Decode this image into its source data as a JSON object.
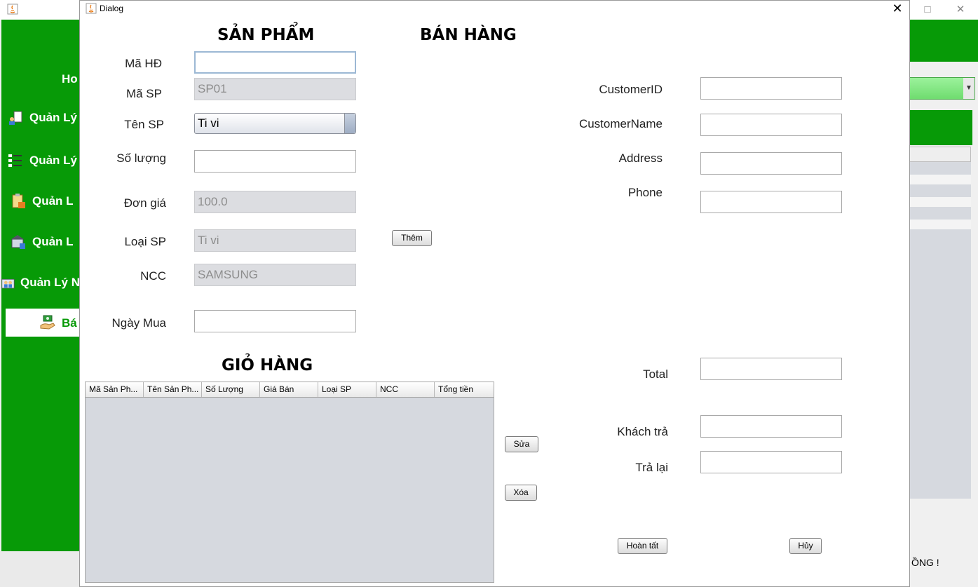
{
  "background": {
    "sidebar_items": [
      "Ho",
      "Quản Lý",
      "Quản Lý",
      "Quản L",
      "Quản L",
      "Quản Lý N",
      "Bá"
    ],
    "status_text": "ỒNG !",
    "window_controls": [
      "□",
      "✕"
    ]
  },
  "dialog": {
    "title": "Dialog",
    "close": "✕",
    "headings": {
      "product": "SẢN PHẨM",
      "sales": "BÁN HÀNG",
      "cart": "GIỎ HÀNG"
    },
    "product_form": {
      "invoice_id": {
        "label": "Mã HĐ",
        "value": ""
      },
      "product_id": {
        "label": "Mã SP",
        "value": "SP01"
      },
      "product_name": {
        "label": "Tên SP",
        "value": "Ti vi"
      },
      "quantity": {
        "label": "Số lượng",
        "value": ""
      },
      "unit_price": {
        "label": "Đơn giá",
        "value": "100.0"
      },
      "category": {
        "label": "Loại SP",
        "value": "Ti vi"
      },
      "supplier": {
        "label": "NCC",
        "value": "SAMSUNG"
      },
      "purchase_date": {
        "label": "Ngày Mua",
        "value": ""
      }
    },
    "customer_form": {
      "customer_id": {
        "label": "CustomerID",
        "value": ""
      },
      "customer_name": {
        "label": "CustomerName",
        "value": ""
      },
      "address": {
        "label": "Address",
        "value": ""
      },
      "phone": {
        "label": "Phone",
        "value": ""
      }
    },
    "payment": {
      "total": {
        "label": "Total",
        "value": ""
      },
      "paid": {
        "label": "Khách trả",
        "value": ""
      },
      "change": {
        "label": "Trả lại",
        "value": ""
      }
    },
    "buttons": {
      "add": "Thêm",
      "edit": "Sửa",
      "delete": "Xóa",
      "complete": "Hoàn tất",
      "cancel": "Hủy"
    },
    "cart_table": {
      "columns": [
        "Mã Sản Ph...",
        "Tên Sản Ph...",
        "Số Lượng",
        "Giá Bán",
        "Loại SP",
        "NCC",
        "Tổng tiền"
      ],
      "rows": []
    }
  }
}
